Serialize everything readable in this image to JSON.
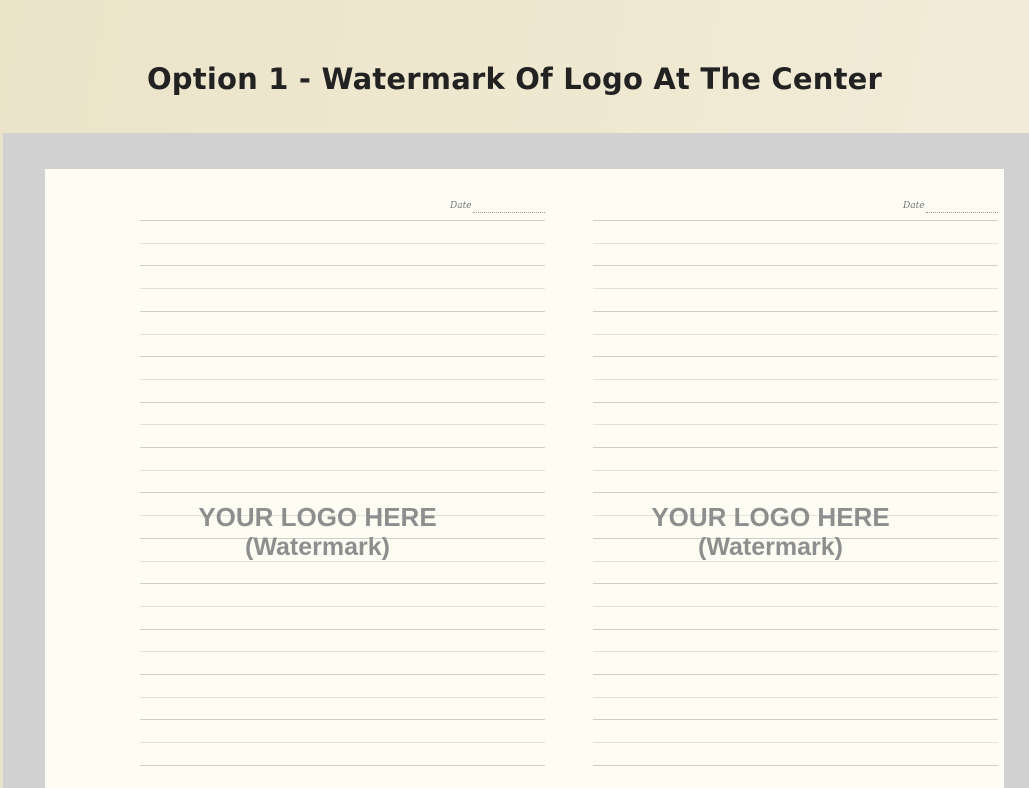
{
  "header": {
    "title": "Option 1 - Watermark Of Logo At The Center"
  },
  "pages": [
    {
      "date_label": "Date",
      "watermark_line1": "YOUR LOGO HERE",
      "watermark_line2": "(Watermark)"
    },
    {
      "date_label": "Date",
      "watermark_line1": "YOUR LOGO HERE",
      "watermark_line2": "(Watermark)"
    }
  ],
  "colors": {
    "header_bg": "#ece5cb",
    "frame_bg": "#d1d1d1",
    "paper_bg": "#fdfdf4",
    "rule_color": "#cfcfc8",
    "watermark_color": "#8e8e8e"
  }
}
